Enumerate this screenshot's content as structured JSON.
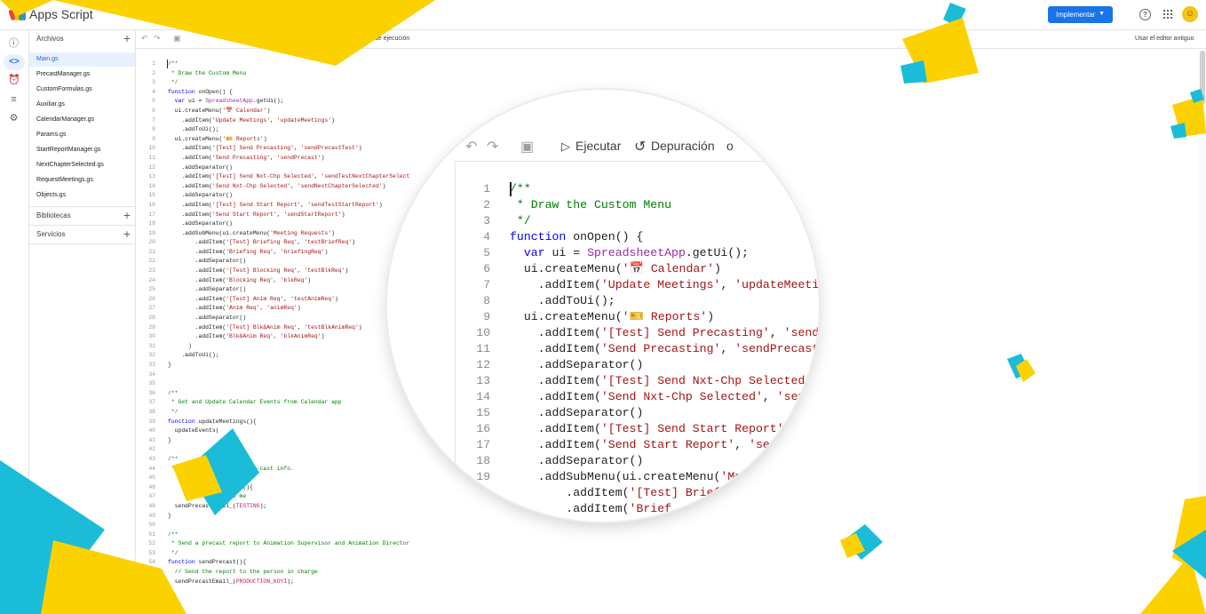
{
  "header": {
    "app_title": "Apps Script",
    "deploy_label": "Implementar",
    "avatar_initial": "☺"
  },
  "rail": {
    "items": [
      "overview",
      "editor",
      "triggers",
      "executions",
      "settings"
    ]
  },
  "files": {
    "section_label": "Archivos",
    "items": [
      "Main.gs",
      "PrecastManager.gs",
      "CustomFormulas.gs",
      "Auxiliar.gs",
      "CalendarManager.gs",
      "Params.gs",
      "StartReportManager.gs",
      "NextChapterSelected.gs",
      "RequestMeetings.gs",
      "Objects.gs"
    ],
    "libraries_label": "Bibliotecas",
    "services_label": "Servicios"
  },
  "toolbar": {
    "log_label": "egistro de ejecución",
    "legacy_editor_label": "Usar el editor antiguo"
  },
  "editor": {
    "line_count": 57
  },
  "magnifier": {
    "run_label": "Ejecutar",
    "debug_label": "Depuración",
    "extra_label": "o",
    "line_start": 1,
    "line_end": 19
  },
  "colors": {
    "accent": "#1a73e8",
    "yellow": "#fbd100",
    "cyan": "#1bbcd8",
    "comment": "#008000",
    "keyword": "#0000ff",
    "string": "#a31515"
  }
}
